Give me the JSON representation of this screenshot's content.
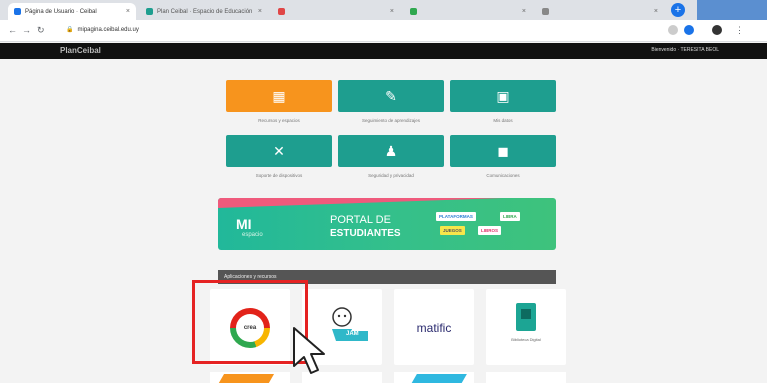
{
  "browser": {
    "tabs": [
      {
        "label": "Página de Usuario · Ceibal",
        "active": true,
        "fav": "#1a73e8"
      },
      {
        "label": "Plan Ceibal · Espacio de Educación",
        "active": false,
        "fav": "#1e9e8f"
      },
      {
        "label": "",
        "active": false,
        "fav": "#e04646"
      },
      {
        "label": "",
        "active": false,
        "fav": "#2fa84f"
      },
      {
        "label": "",
        "active": false,
        "fav": "#888888"
      }
    ],
    "new_tab": "+",
    "url": "mipagina.ceibal.edu.uy"
  },
  "site": {
    "logo": "PlanCeibal",
    "user": "Bienvenido · TERESITA BEOL"
  },
  "tiles": [
    {
      "icon": "grid-icon",
      "glyph": "▦",
      "color": "#f7941d",
      "caption": "Recursos y espacios"
    },
    {
      "icon": "clipboard-icon",
      "glyph": "✎",
      "color": "#1e9e8f",
      "caption": "Seguimiento de aprendizajes"
    },
    {
      "icon": "book-icon",
      "glyph": "▣",
      "color": "#1e9e8f",
      "caption": "Mis datos"
    },
    {
      "icon": "tools-icon",
      "glyph": "✕",
      "color": "#1e9e8f",
      "caption": "Soporte de dispositivos"
    },
    {
      "icon": "user-hands-icon",
      "glyph": "♟",
      "color": "#1e9e8f",
      "caption": "Seguridad y privacidad"
    },
    {
      "icon": "bookmark-icon",
      "glyph": "◼",
      "color": "#1e9e8f",
      "caption": "Comunicaciones"
    }
  ],
  "banner": {
    "mi": "MI",
    "mi_sub": "espacio",
    "portal_line1": "PORTAL DE",
    "portal_line2": "ESTUDIANTES",
    "chips": [
      "PLATAFORMAS",
      "LIBRA",
      "JUEGOS",
      "LIBROS"
    ]
  },
  "section": {
    "title": "Aplicaciones y recursos"
  },
  "apps": [
    {
      "name": "crea",
      "label": "crea"
    },
    {
      "name": "jam",
      "label": "JAM"
    },
    {
      "name": "matific",
      "label": "matific"
    },
    {
      "name": "biblioteca",
      "label": "Biblioteca Digital"
    }
  ]
}
